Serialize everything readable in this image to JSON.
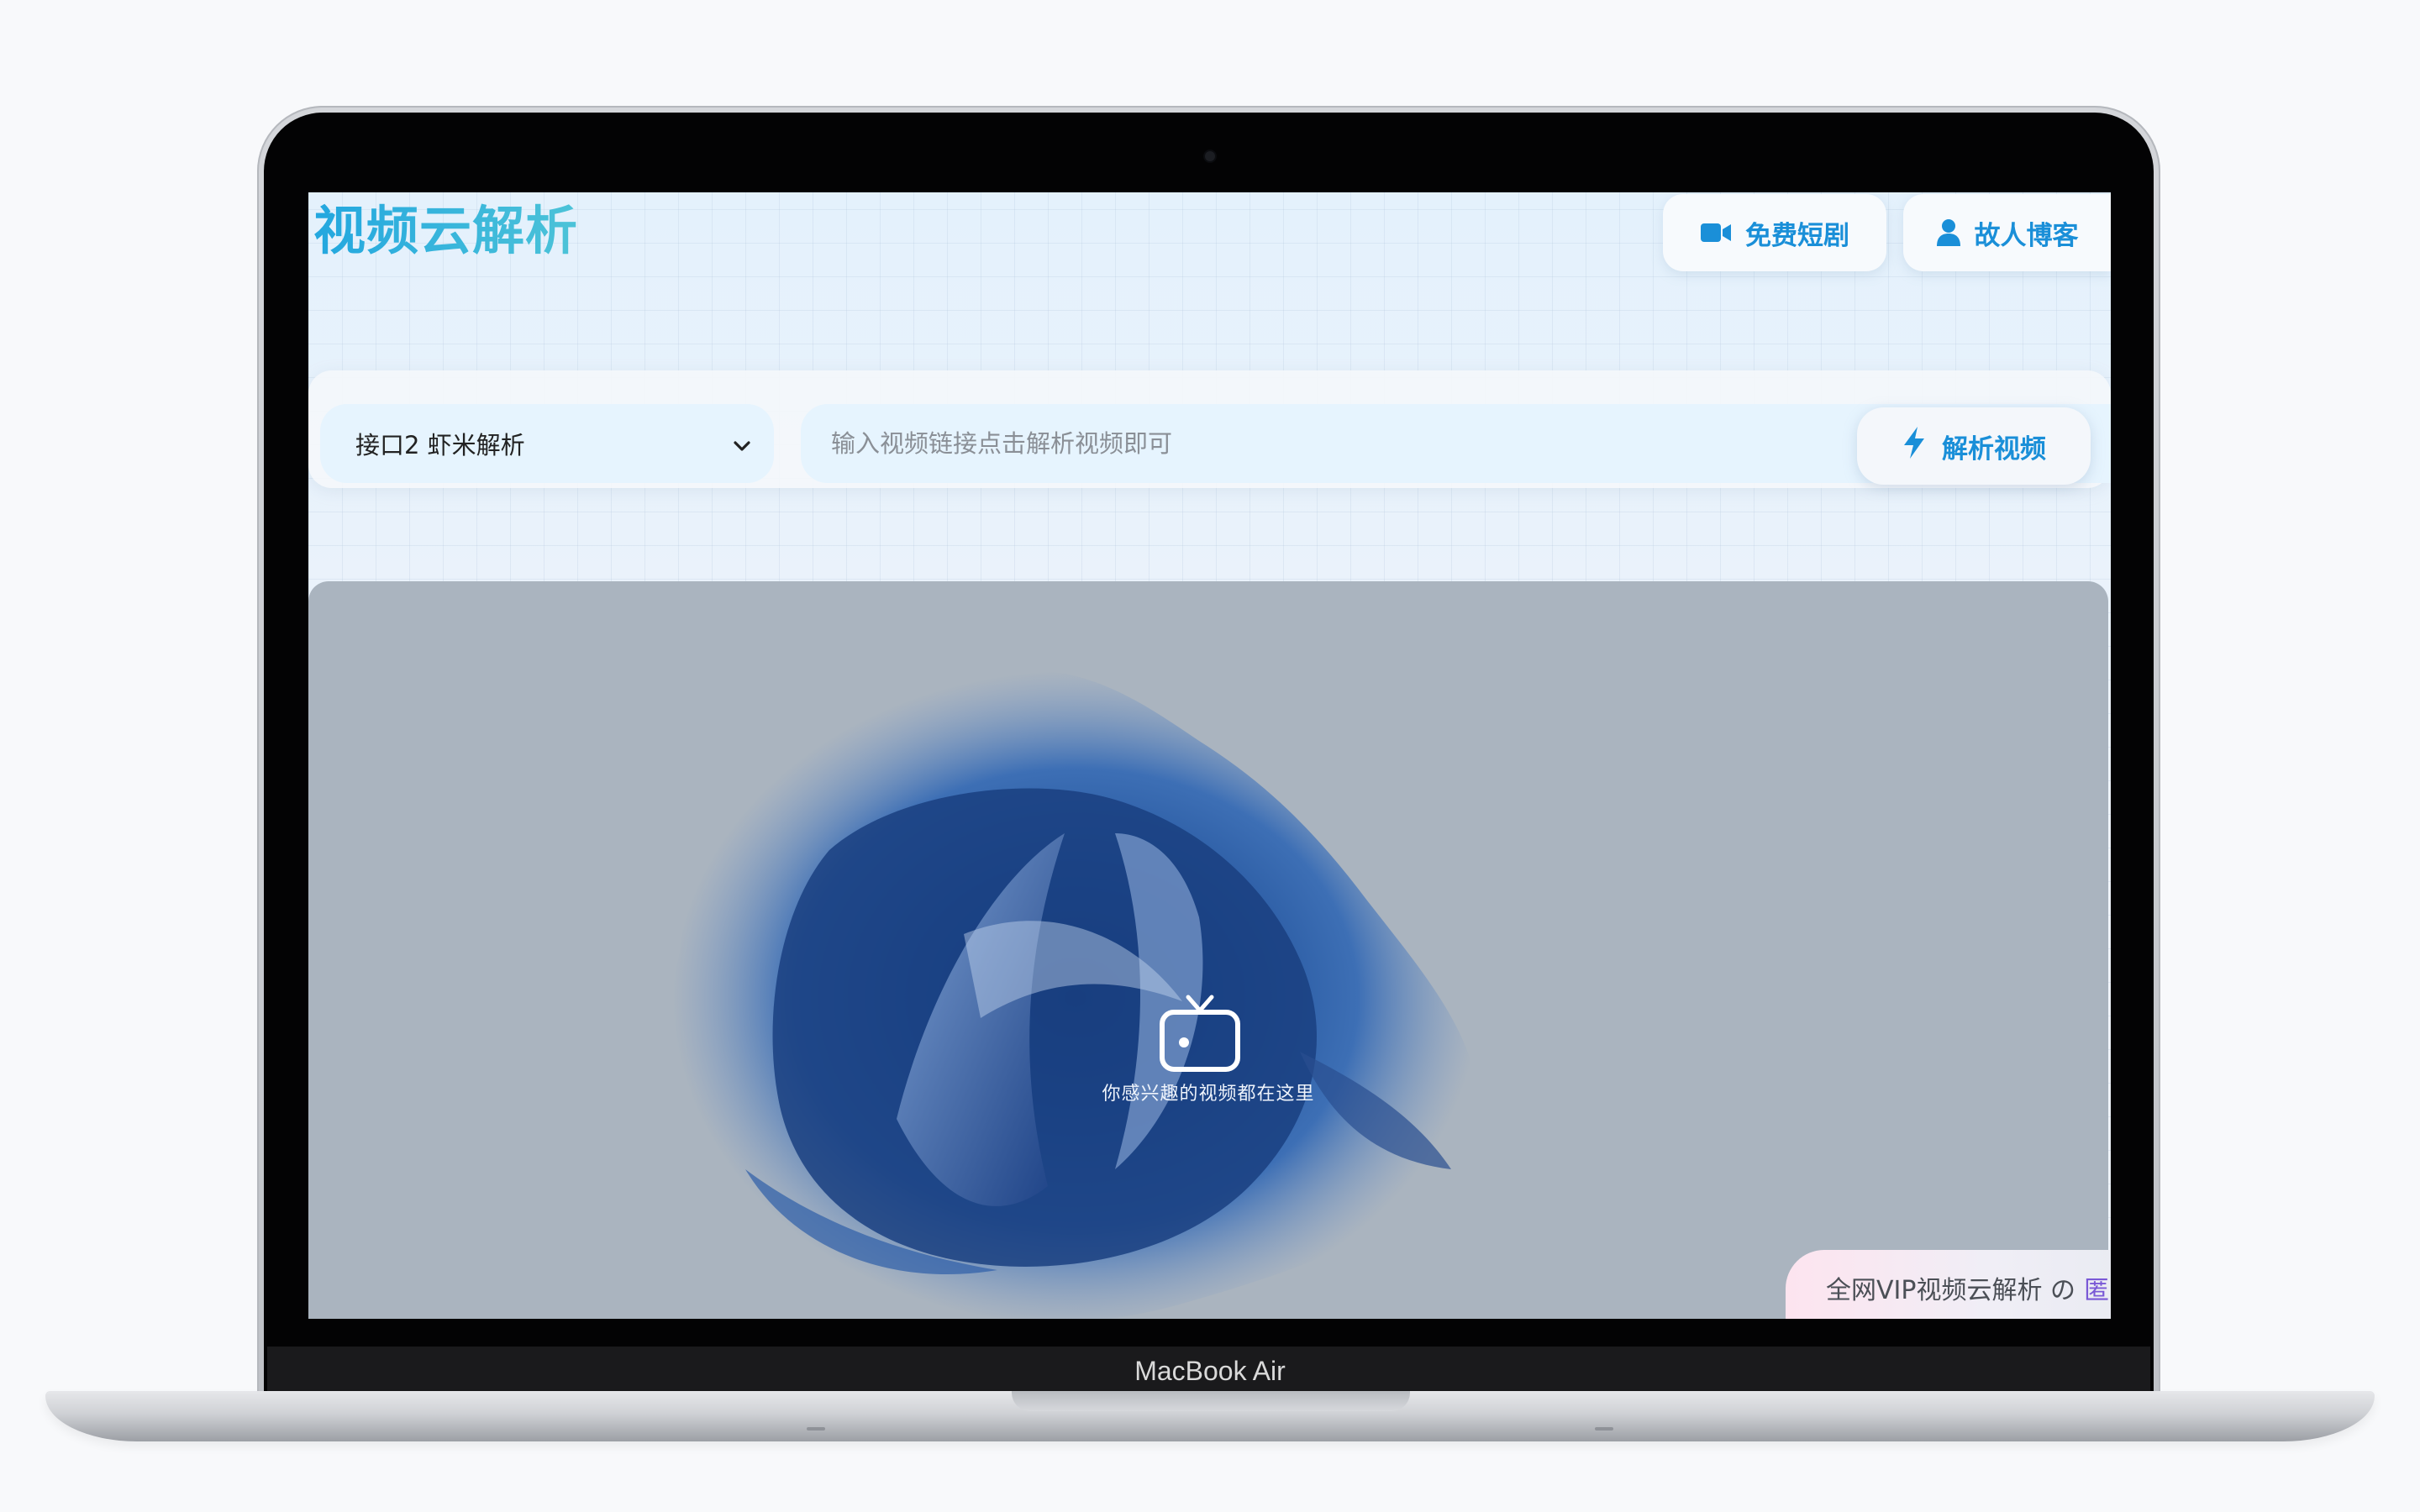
{
  "laptop": {
    "brand": "MacBook Air"
  },
  "site": {
    "logo": "视频云解析",
    "nav": {
      "drama": {
        "label": "免费短剧",
        "icon": "video-camera-icon"
      },
      "blog": {
        "label": "故人博客",
        "icon": "user-icon"
      }
    },
    "search": {
      "api_selected": "接口2 虾米解析",
      "url_placeholder": "输入视频链接点击解析视频即可",
      "url_value": "",
      "parse_label": "解析视频",
      "parse_icon": "lightning-bolt-icon"
    },
    "player": {
      "icon": "tv-icon",
      "caption": "你感兴趣的视频都在这里"
    },
    "marquee": {
      "text": "全网VIP视频云解析 の",
      "tail": "匿"
    }
  },
  "colors": {
    "accent": "#1a8fd8",
    "logo_gradient_start": "#23a7df",
    "logo_gradient_end": "#4cc3d8",
    "input_bg": "#e6f4fe",
    "player_bg": "#aab4bf"
  }
}
